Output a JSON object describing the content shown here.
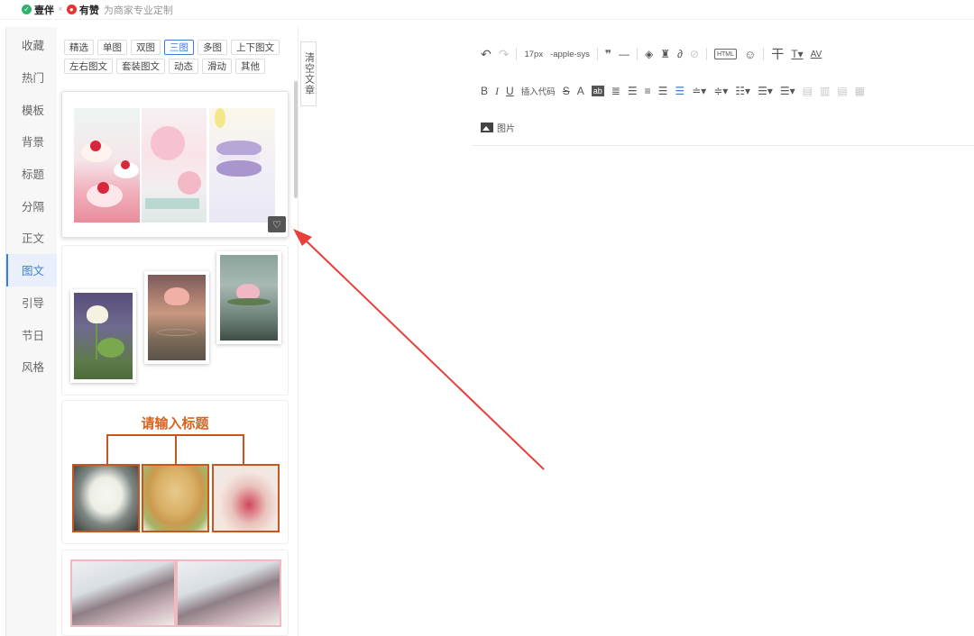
{
  "header": {
    "brand1": "壹伴",
    "close_mark": "×",
    "brand2": "有赞",
    "tagline": "为商家专业定制"
  },
  "sidebar": {
    "items": [
      {
        "label": "收藏"
      },
      {
        "label": "热门"
      },
      {
        "label": "模板"
      },
      {
        "label": "背景"
      },
      {
        "label": "标题"
      },
      {
        "label": "分隔"
      },
      {
        "label": "正文"
      },
      {
        "label": "图文"
      },
      {
        "label": "引导"
      },
      {
        "label": "节日"
      },
      {
        "label": "风格"
      }
    ],
    "active": "图文"
  },
  "filter_tags": [
    "精选",
    "单图",
    "双图",
    "三图",
    "多图",
    "上下图文",
    "左右图文",
    "套装图文",
    "动态",
    "滑动",
    "其他"
  ],
  "active_tag": "三图",
  "templates": {
    "card3_title": "请输入标题",
    "favorite_icon": "heart-icon"
  },
  "clear_button": "清空文章",
  "toolbar": {
    "font_size": "17px",
    "font_family": "-apple-sys",
    "insert_code": "插入代码",
    "image_label": "图片",
    "bold": "B",
    "italic": "I",
    "underline": "U",
    "strike": "S",
    "font_color": "A",
    "highlight": "ab",
    "letter_spacing": "AV"
  },
  "colors": {
    "accent": "#3b7ed8",
    "arrow": "#e8403a",
    "template_orange": "#c8571f"
  }
}
